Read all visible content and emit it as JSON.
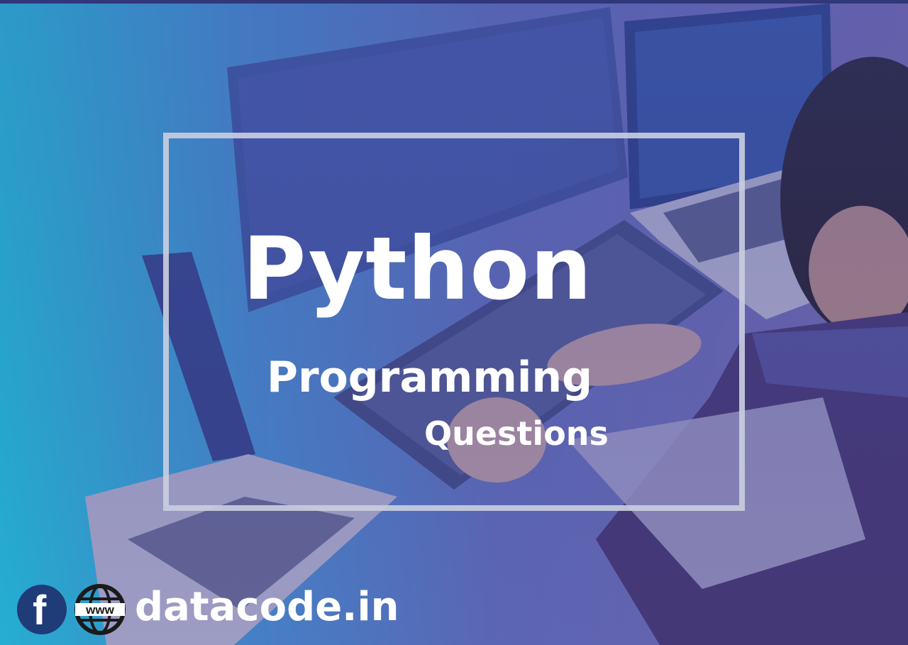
{
  "title": "Python",
  "subtitle": "Programming",
  "subtitle_second_line": "Questions",
  "footer": {
    "facebook_icon": "facebook-icon",
    "www_icon": "globe-www-icon",
    "website": "datacode.in"
  },
  "colors": {
    "left_gradient": "#22c4e0",
    "overlay_blue": "#5562b8",
    "frame_border": "#c8cdde",
    "text": "#ffffff",
    "icon_dark": "#1f3b78"
  }
}
